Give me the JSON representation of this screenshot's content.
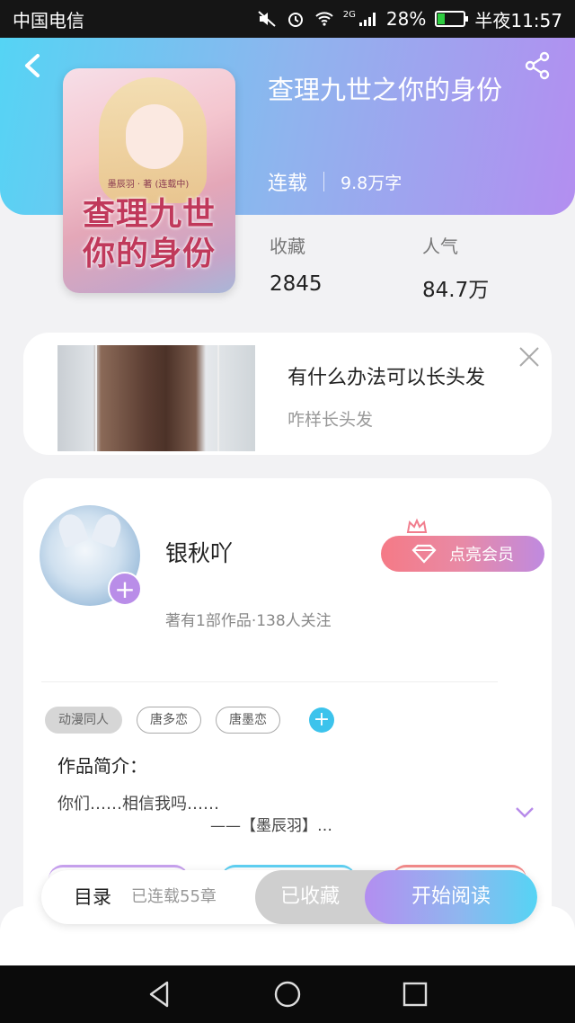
{
  "status_bar": {
    "carrier": "中国电信",
    "network": "2G",
    "battery": "28%",
    "battery_level": 0.28,
    "time": "半夜11:57"
  },
  "book": {
    "title": "查理九世之你的身份",
    "cover_title": "查理九世你的身份",
    "cover_small": "墨辰羽 · 著 (连载中)",
    "status": "连载",
    "word_count": "9.8万字",
    "stats": [
      {
        "label": "收藏",
        "value": "2845"
      },
      {
        "label": "人气",
        "value": "84.7万"
      }
    ]
  },
  "ad": {
    "title": "有什么办法可以长头发",
    "subtitle": "咋样长头发"
  },
  "author": {
    "name": "银秋吖",
    "info": "著有1部作品·138人关注",
    "vip_label": "点亮会员"
  },
  "tags": [
    "动漫同人",
    "唐多恋",
    "唐墨恋"
  ],
  "intro": {
    "label": "作品简介：",
    "text": "你们……相信我吗……",
    "signature": "——【墨辰羽】…"
  },
  "action_bar": {
    "toc": "目录",
    "chapters": "已连载55章",
    "collected": "已收藏",
    "start": "开始阅读"
  },
  "colors": {
    "gradient_start": "#55d4f4",
    "gradient_end": "#b38ef0",
    "vip_pink": "#f57a86",
    "tag_add": "#3cc3ec"
  }
}
